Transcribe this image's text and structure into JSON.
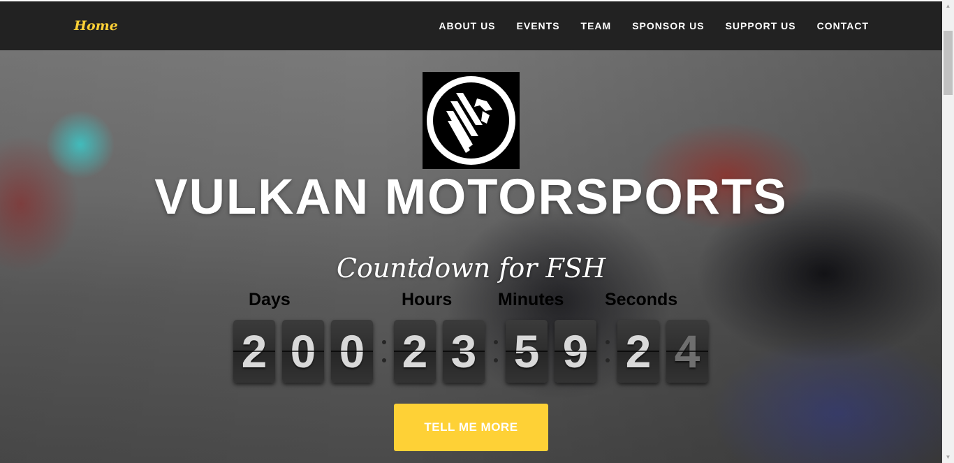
{
  "navbar": {
    "brand": "Home",
    "links": [
      {
        "label": "About Us"
      },
      {
        "label": "Events"
      },
      {
        "label": "Team"
      },
      {
        "label": "Sponsor Us"
      },
      {
        "label": "Support Us"
      },
      {
        "label": "Contact"
      }
    ]
  },
  "hero": {
    "logo_icon": "vulkan-phoenix-logo",
    "title": "VULKAN MOTORSPORTS",
    "subtitle": "Countdown for FSH",
    "countdown": {
      "labels": {
        "days": "Days",
        "hours": "Hours",
        "minutes": "Minutes",
        "seconds": "Seconds"
      },
      "digits": {
        "days": [
          "2",
          "0",
          "0"
        ],
        "hours": [
          "2",
          "3"
        ],
        "minutes": [
          "5",
          "9"
        ],
        "seconds": [
          "2",
          "4"
        ]
      }
    },
    "cta_label": "Tell Me More"
  },
  "colors": {
    "navbar_bg": "#222222",
    "accent": "#fed136",
    "digit_bg": "#333333"
  }
}
